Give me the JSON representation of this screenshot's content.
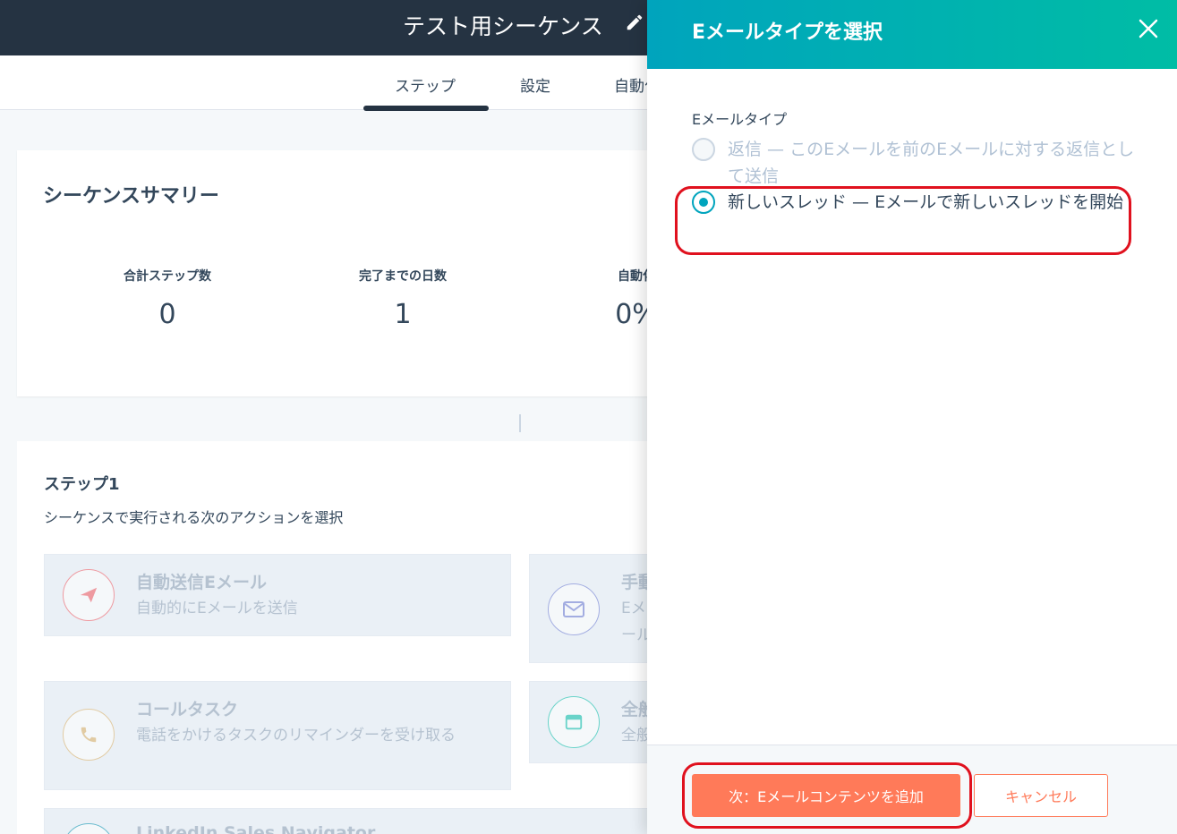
{
  "header": {
    "sequence_title": "テスト用シーケンス"
  },
  "tabs": [
    {
      "label": "ステップ"
    },
    {
      "label": "設定"
    },
    {
      "label": "自動化"
    }
  ],
  "summary": {
    "title": "シーケンスサマリー",
    "stats": [
      {
        "label": "合計ステップ数",
        "value": "0"
      },
      {
        "label": "完了までの日数",
        "value": "1"
      },
      {
        "label": "自動化",
        "value": "0%"
      }
    ]
  },
  "step": {
    "title": "ステップ1",
    "subtitle": "シーケンスで実行される次のアクションを選択",
    "actions": [
      {
        "title": "自動送信Eメール",
        "desc": "自動的にEメールを送信",
        "icon": "paper-plane-icon",
        "color": "#f2545b"
      },
      {
        "title": "手動Eメール",
        "desc": "Eメールタスクのリマインダーを受け取る",
        "icon": "envelope-icon",
        "color": "#6a78d1"
      },
      {
        "title": "コールタスク",
        "desc": "電話をかけるタスクのリマインダーを受け取る",
        "icon": "phone-icon",
        "color": "#dbae60"
      },
      {
        "title": "全般タスク",
        "desc": "全般タスク",
        "icon": "task-icon",
        "color": "#00bda5"
      },
      {
        "title": "LinkedIn Sales Navigator"
      }
    ]
  },
  "panel": {
    "title": "Eメールタイプを選択",
    "field_label": "Eメールタイプ",
    "options": [
      {
        "text": "返信 — このEメールを前のEメールに対する返信として送信",
        "checked": false,
        "disabled": true
      },
      {
        "text": "新しいスレッド — Eメールで新しいスレッドを開始",
        "checked": true,
        "disabled": false
      }
    ],
    "next_button": "次：Eメールコンテンツを追加",
    "cancel_button": "キャンセル"
  },
  "colors": {
    "topbar": "#253342",
    "panel_gradient_start": "#00a4bd",
    "panel_gradient_end": "#00bda5",
    "primary_button": "#ff7a59",
    "annotation_red": "#e0111e"
  }
}
